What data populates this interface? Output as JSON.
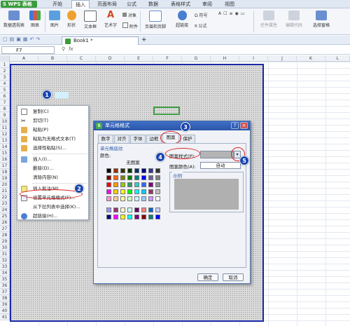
{
  "app": {
    "logo_label": "S WPS 表格",
    "logo_dropdown": "▾"
  },
  "menu": [
    "开始",
    "插入",
    "页面布局",
    "公式",
    "数据",
    "表格样式",
    "审阅",
    "视图"
  ],
  "ribbon": {
    "big_buttons": [
      "数据透视表",
      "图表",
      "图片",
      "形状",
      "文本框",
      "艺术字",
      "页眉和页脚",
      "超链接",
      "选择窗格"
    ],
    "small_buttons": [
      "对象",
      "附件",
      "符号",
      "公式",
      "控件属性",
      "编辑代码"
    ]
  },
  "tabbar": {
    "doc_name": "Book1 *",
    "add_symbol": "+"
  },
  "formula": {
    "cell_ref": "F7",
    "fx": "fx"
  },
  "columns": [
    "A",
    "B",
    "C",
    "D",
    "E",
    "F",
    "G",
    "H",
    "I",
    "J",
    "K",
    "L"
  ],
  "rows": [
    "1",
    "2",
    "3",
    "4",
    "5",
    "6",
    "7",
    "8",
    "9",
    "10",
    "11",
    "12",
    "13",
    "14",
    "15",
    "16",
    "17",
    "18",
    "19",
    "20",
    "21",
    "22",
    "23",
    "24",
    "25",
    "26",
    "27",
    "28",
    "29",
    "30",
    "31",
    "32",
    "33",
    "34",
    "35",
    "36",
    "37",
    "38",
    "39",
    "40",
    "41"
  ],
  "context_menu": [
    "复制(C)",
    "剪切(T)",
    "粘贴(P)",
    "粘贴为无格式文本(T)",
    "选择性粘贴(S)...",
    "插入(I)...",
    "删除(D)...",
    "清除内容(N)",
    "插入批注(M)",
    "设置单元格格式(F)...",
    "从下拉列表中选择(K)...",
    "超链接(H)..."
  ],
  "dialog": {
    "title": "单元格格式",
    "tabs": [
      "数字",
      "对齐",
      "字体",
      "边框",
      "图案",
      "保护"
    ],
    "active_tab": "图案",
    "section_title": "单元格底纹",
    "color_label": "颜色:",
    "no_color": "无图案",
    "pattern_style_label": "图案样式(P):",
    "pattern_color_label": "图案颜色(A):",
    "pattern_color_value": "自动",
    "sample_label": "示例",
    "ok": "确定",
    "cancel": "取消",
    "close_symbol": "×",
    "help_symbol": "?"
  },
  "badges": [
    "1",
    "2",
    "3",
    "4",
    "5"
  ],
  "colors": {
    "accent": "#1a45b0",
    "title_bar": "#2b56a8",
    "wps_green": "#3a9d3a",
    "highlight": "#d22222"
  }
}
